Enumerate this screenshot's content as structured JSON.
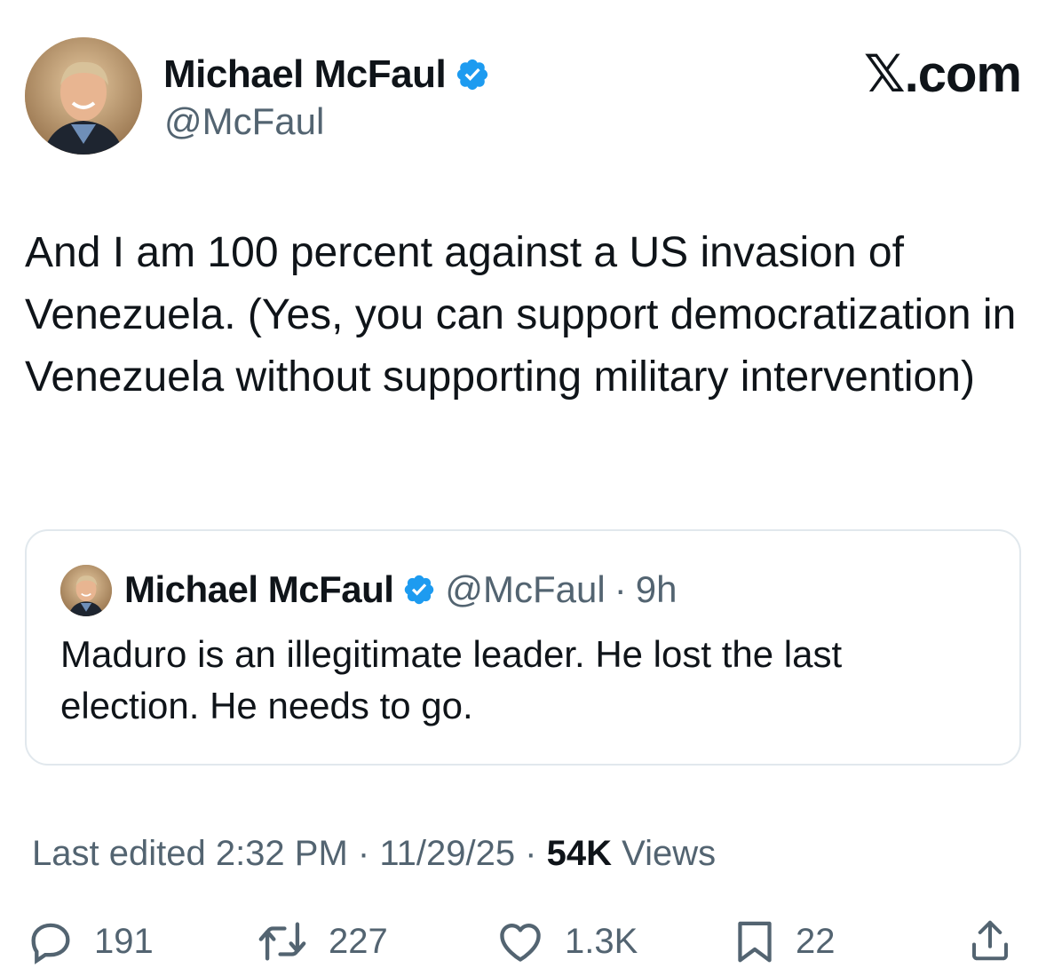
{
  "author": {
    "display_name": "Michael McFaul",
    "handle": "@McFaul",
    "verified": true
  },
  "brand": "𝕏.com",
  "tweet": {
    "text": "And I am 100 percent against a US invasion of Venezuela. (Yes, you can support democratization in Venezuela without supporting military intervention)"
  },
  "quoted_tweet": {
    "display_name": "Michael McFaul",
    "handle": "@McFaul",
    "separator": "·",
    "time": "9h",
    "text": "Maduro is an illegitimate leader. He lost the last election. He needs to go."
  },
  "meta": {
    "edited_label": "Last edited 2:32 PM · 11/29/25",
    "separator": " · ",
    "views_count": "54K",
    "views_label": " Views"
  },
  "actions": {
    "replies": "191",
    "reposts": "227",
    "likes": "1.3K",
    "bookmarks": "22"
  },
  "colors": {
    "verified_badge": "#1d9bf0",
    "secondary_text": "#536471",
    "primary_text": "#0f1419",
    "quote_border": "#e1e8ed"
  },
  "icons": [
    "verified-badge-icon",
    "reply-icon",
    "repost-icon",
    "like-icon",
    "bookmark-icon",
    "share-icon"
  ]
}
